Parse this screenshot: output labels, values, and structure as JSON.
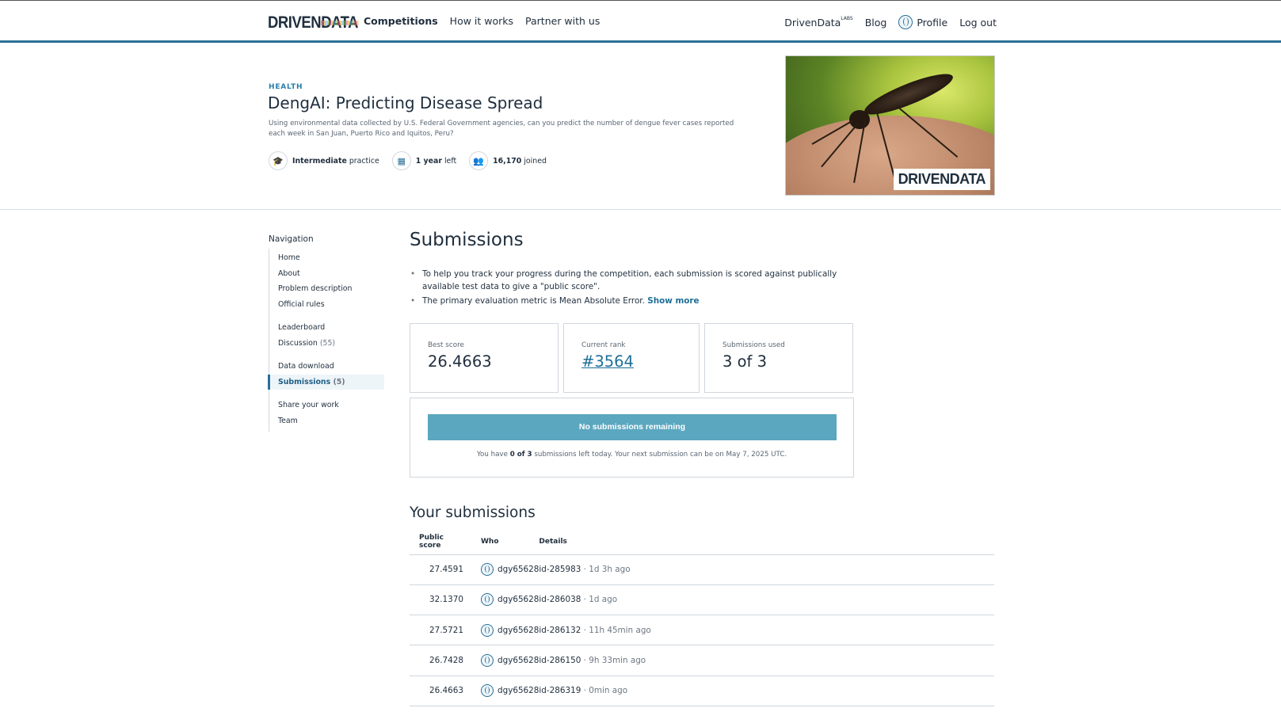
{
  "header": {
    "logo_left": "DRIVEN",
    "logo_right": "DATA",
    "nav": [
      "Competitions",
      "How it works",
      "Partner with us"
    ],
    "right_nav": {
      "labs": "DrivenData",
      "labs_sup": "LABS",
      "blog": "Blog",
      "profile": "Profile",
      "logout": "Log out"
    }
  },
  "hero": {
    "category": "HEALTH",
    "title": "DengAI: Predicting Disease Spread",
    "description": "Using environmental data collected by U.S. Federal Government agencies, can you predict the number of dengue fever cases reported each week in San Juan, Puerto Rico and Iquitos, Peru?",
    "stats": [
      {
        "icon": "graduation-cap-icon",
        "bold": "Intermediate",
        "rest": "practice"
      },
      {
        "icon": "calendar-icon",
        "bold": "1 year",
        "rest": "left"
      },
      {
        "icon": "users-icon",
        "bold": "16,170",
        "rest": "joined"
      }
    ],
    "image_badge_left": "DRIVEN",
    "image_badge_right": "DATA"
  },
  "sidebar": {
    "title": "Navigation",
    "groups": [
      [
        {
          "label": "Home"
        },
        {
          "label": "About"
        },
        {
          "label": "Problem description"
        },
        {
          "label": "Official rules"
        }
      ],
      [
        {
          "label": "Leaderboard"
        },
        {
          "label": "Discussion",
          "count": "(55)"
        }
      ],
      [
        {
          "label": "Data download"
        },
        {
          "label": "Submissions",
          "count": "(5)",
          "active": true
        }
      ],
      [
        {
          "label": "Share your work"
        },
        {
          "label": "Team"
        }
      ]
    ]
  },
  "main": {
    "title": "Submissions",
    "bullet1": "To help you track your progress during the competition, each submission is scored against publically available test data to give a \"public score\".",
    "bullet2": "The primary evaluation metric is Mean Absolute Error.",
    "show_more": "Show more",
    "cards": [
      {
        "label": "Best score",
        "value": "26.4663"
      },
      {
        "label": "Current rank",
        "value": "#3564"
      },
      {
        "label": "Submissions used",
        "value": "3 of 3"
      }
    ],
    "submit_button": "No submissions remaining",
    "note_pre": "You have",
    "note_bold": "0 of 3",
    "note_post": "submissions left today. Your next submission can be on May 7, 2025 UTC."
  },
  "your_submissions": {
    "title": "Your submissions",
    "columns": [
      "Public score",
      "Who",
      "Details"
    ],
    "rows": [
      {
        "score": "27.4591",
        "who": "dgy65628",
        "id": "id-285983",
        "ago": " · 1d 3h ago"
      },
      {
        "score": "32.1370",
        "who": "dgy65628",
        "id": "id-286038",
        "ago": " · 1d ago"
      },
      {
        "score": "27.5721",
        "who": "dgy65628",
        "id": "id-286132",
        "ago": " · 11h 45min ago"
      },
      {
        "score": "26.7428",
        "who": "dgy65628",
        "id": "id-286150",
        "ago": " · 9h 33min ago"
      },
      {
        "score": "26.4663",
        "who": "dgy65628",
        "id": "id-286319",
        "ago": " · 0min ago"
      }
    ]
  }
}
